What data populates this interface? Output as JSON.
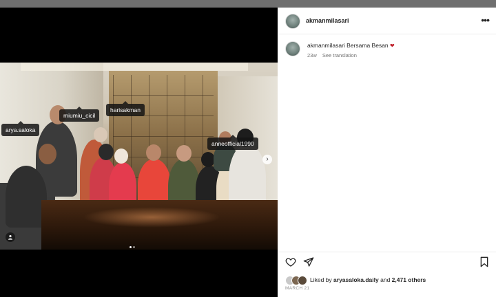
{
  "post": {
    "username": "akmanmilasari",
    "caption_user": "akmanmilasari",
    "caption_text": "Bersama Besan",
    "caption_emoji": "❤",
    "age": "23w",
    "see_translation": "See translation",
    "liked_by_prefix": "Liked by",
    "liked_by_user": "aryasaloka.daily",
    "liked_by_and": "and",
    "liked_by_others": "2,471 others",
    "date": "MARCH 21"
  },
  "tags": {
    "arya": "arya.saloka",
    "miumiu": "miumiu_cicil",
    "haris": "harisakman",
    "anne": "anneofficial1990"
  },
  "icons": {
    "more": "more-options-icon",
    "like": "heart-icon",
    "share": "paper-plane-icon",
    "save": "bookmark-icon",
    "next": "chevron-right-icon",
    "tagged": "user-tag-icon"
  },
  "carousel": {
    "total": 2,
    "current": 1
  },
  "colors": {
    "heart": "#c0212c",
    "text": "#262626",
    "meta": "#737373"
  }
}
